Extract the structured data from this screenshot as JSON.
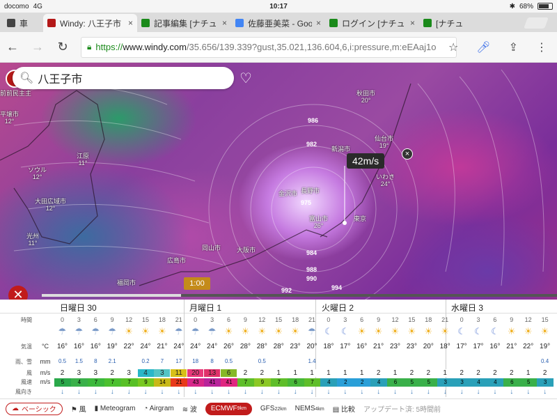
{
  "status": {
    "carrier": "docomo",
    "network": "4G",
    "time": "10:17",
    "battery": "68%"
  },
  "tabs": [
    {
      "title": "車",
      "active": false
    },
    {
      "title": "Windy: 八王子市",
      "active": true
    },
    {
      "title": "記事編集 [ナチュ",
      "active": false
    },
    {
      "title": "佐藤亜美菜 - Goo",
      "active": false
    },
    {
      "title": "ログイン [ナチュ",
      "active": false
    },
    {
      "title": "[ナチュ",
      "active": false
    }
  ],
  "address": {
    "scheme": "https://",
    "host": "www.windy.com",
    "path": "/35.656/139.339?gust,35.021,136.604,6,i:pressure,m:eEAaj1o"
  },
  "search": {
    "value": "八王子市"
  },
  "map": {
    "wind_label": "42m/s",
    "time_badge": "1:00",
    "cities": [
      {
        "name": "平壌市",
        "val": "12°"
      },
      {
        "name": "ソウル",
        "val": "12°"
      },
      {
        "name": "大田広域市",
        "val": "12°"
      },
      {
        "name": "光州",
        "val": "11°"
      },
      {
        "name": "秋田市",
        "val": "20°"
      },
      {
        "name": "仙台市",
        "val": "19°"
      },
      {
        "name": "新潟市",
        "val": ""
      },
      {
        "name": "長野市",
        "val": ""
      },
      {
        "name": "富山市",
        "val": "26°"
      },
      {
        "name": "金沢市",
        "val": ""
      },
      {
        "name": "東京",
        "val": ""
      },
      {
        "name": "大阪市",
        "val": ""
      },
      {
        "name": "岡山市",
        "val": ""
      },
      {
        "name": "広島市",
        "val": ""
      },
      {
        "name": "福岡市",
        "val": ""
      },
      {
        "name": "いわき",
        "val": "24°"
      },
      {
        "name": "前前民主主",
        "val": ""
      },
      {
        "name": "江原",
        "val": "11°"
      }
    ],
    "isobars": [
      "986",
      "982",
      "975",
      "984",
      "988",
      "990",
      "992",
      "994"
    ]
  },
  "forecast": {
    "days": [
      "日曜日 30",
      "月曜日 1",
      "火曜日 2",
      "水曜日 3"
    ],
    "row_labels": {
      "time": "時間",
      "temp": "気温",
      "rain": "雨、雪",
      "wind": "風",
      "gust": "風速",
      "dir": "風向き"
    },
    "units": {
      "temp": "°C",
      "rain": "mm",
      "wind": "m/s",
      "gust": "m/s"
    },
    "hours": [
      "0",
      "3",
      "6",
      "9",
      "12",
      "15",
      "18",
      "21",
      "0",
      "3",
      "6",
      "9",
      "12",
      "15",
      "18",
      "21",
      "0",
      "3",
      "6",
      "9",
      "12",
      "15",
      "18",
      "21",
      "0",
      "3",
      "6",
      "9",
      "12",
      "15"
    ],
    "temps": [
      "16°",
      "16°",
      "16°",
      "19°",
      "22°",
      "24°",
      "21°",
      "24°",
      "24°",
      "24°",
      "26°",
      "28°",
      "28°",
      "28°",
      "23°",
      "20°",
      "18°",
      "17°",
      "16°",
      "21°",
      "23°",
      "23°",
      "20°",
      "18°",
      "17°",
      "17°",
      "16°",
      "21°",
      "22°",
      "19°"
    ],
    "rain": [
      "0.5",
      "1.5",
      "8",
      "2.1",
      "",
      "0.2",
      "7",
      "17",
      "18",
      "8",
      "0.5",
      "",
      "0.5",
      "",
      "",
      "1.4",
      "",
      "",
      "",
      "",
      "",
      "",
      "",
      "",
      "",
      "",
      "",
      "",
      "",
      "0.4"
    ],
    "wind": [
      "2",
      "3",
      "3",
      "2",
      "3",
      "4",
      "3",
      "11",
      "20",
      "13",
      "6",
      "2",
      "2",
      "1",
      "1",
      "1",
      "1",
      "1",
      "1",
      "2",
      "1",
      "2",
      "2",
      "1",
      "2",
      "2",
      "2",
      "2",
      "1",
      "2"
    ],
    "gust": [
      "5",
      "4",
      "7",
      "7",
      "7",
      "9",
      "14",
      "21",
      "43",
      "41",
      "41",
      "7",
      "9",
      "7",
      "6",
      "7",
      "4",
      "2",
      "2",
      "4",
      "6",
      "5",
      "5",
      "3",
      "3",
      "4",
      "4",
      "6",
      "5",
      "3"
    ],
    "weather_icons": [
      "rain-cloud",
      "rain-cloud",
      "rain-cloud",
      "rain-cloud",
      "sun",
      "sun",
      "sun",
      "rain-cloud",
      "rain-cloud",
      "rain-cloud",
      "sun",
      "sun",
      "sun",
      "sun",
      "sun",
      "rain-cloud",
      "moon",
      "moon",
      "sun",
      "sun",
      "sun",
      "sun",
      "sun",
      "sun",
      "moon",
      "moon",
      "moon",
      "sun",
      "sun",
      "sun"
    ],
    "gust_colors": [
      "#2aa84a",
      "#3ab04a",
      "#3cb83c",
      "#4cc030",
      "#58c026",
      "#78c820",
      "#c8b818",
      "#e83a1a",
      "#d8278a",
      "#b8249a",
      "#e02680",
      "#5fbe2a",
      "#8cc825",
      "#5fbe2a",
      "#48b838",
      "#5fbe2a",
      "#2aa0b8",
      "#2a9fd8",
      "#2a9fd8",
      "#2aa0b8",
      "#3ab04a",
      "#3ab04a",
      "#3ab04a",
      "#2aa0b8",
      "#2aa0b8",
      "#2aa0b8",
      "#2aa0b8",
      "#3ab04a",
      "#3ab04a",
      "#2aa0b8"
    ],
    "wind_colors": [
      "#fff",
      "#fff",
      "#fff",
      "#fff",
      "#fff",
      "#2ab7c8",
      "#54c4c4",
      "#d8c018",
      "#e8387a",
      "#e0306a",
      "#86b828",
      "#fff",
      "#fff",
      "#fff",
      "#fff",
      "#fff",
      "#fff",
      "#fff",
      "#fff",
      "#fff",
      "#fff",
      "#fff",
      "#fff",
      "#fff",
      "#fff",
      "#fff",
      "#fff",
      "#fff",
      "#fff",
      "#fff"
    ]
  },
  "bottombar": {
    "basic": "ベーシック",
    "wind": "風",
    "meteogram": "Meteogram",
    "airgram": "Airgram",
    "waves": "波",
    "ecmwf": "ECMWF",
    "ecmwf_res": "9km",
    "gfs": "GFS",
    "gfs_res": "22km",
    "nems": "NEMS",
    "nems_res": "4km",
    "compare": "比較",
    "update": "アップデート済:",
    "update_ago": "5時間前"
  }
}
